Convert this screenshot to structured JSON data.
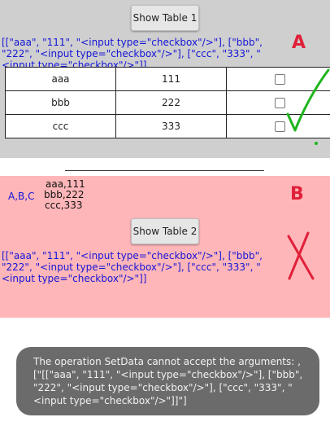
{
  "panel_a": {
    "button_label": "Show Table 1",
    "array_text": "[[\"aaa\", \"111\", \"<input type=\"checkbox\"/>\"], [\"bbb\", \"222\", \"<input type=\"checkbox\"/>\"], [\"ccc\", \"333\", \"<input type=\"checkbox\"/>\"]]",
    "label": "A",
    "rows": [
      {
        "name": "aaa",
        "value": "111"
      },
      {
        "name": "bbb",
        "value": "222"
      },
      {
        "name": "ccc",
        "value": "333"
      }
    ],
    "annotation": "checkmark-icon",
    "annotation_color": "#1fb51f"
  },
  "panel_b": {
    "label": "B",
    "left_list": "A,B,C",
    "right_list": [
      "aaa,111",
      "bbb,222",
      "ccc,333"
    ],
    "button_label": "Show Table 2",
    "array_text": "[[\"aaa\", \"111\", \"<input type=\"checkbox\"/>\"], [\"bbb\", \"222\", \"<input type=\"checkbox\"/>\"], [\"ccc\", \"333\", \"<input type=\"checkbox\"/>\"]]",
    "annotation": "cross-icon",
    "annotation_color": "#e0203a"
  },
  "toast": {
    "message": "The operation SetData cannot accept the arguments: , [\"[[\"aaa\", \"111\", \"<input type=\"checkbox\"/>\"], [\"bbb\", \"222\", \"<input type=\"checkbox\"/>\"], [\"ccc\", \"333\", \"<input type=\"checkbox\"/>\"]]\"]"
  },
  "colors": {
    "panel_a_bg": "#cfcfcf",
    "panel_b_bg": "#ffb6b9",
    "array_text": "#1515d6",
    "label": "#e0203a",
    "toast_bg": "#6b6b6b"
  }
}
